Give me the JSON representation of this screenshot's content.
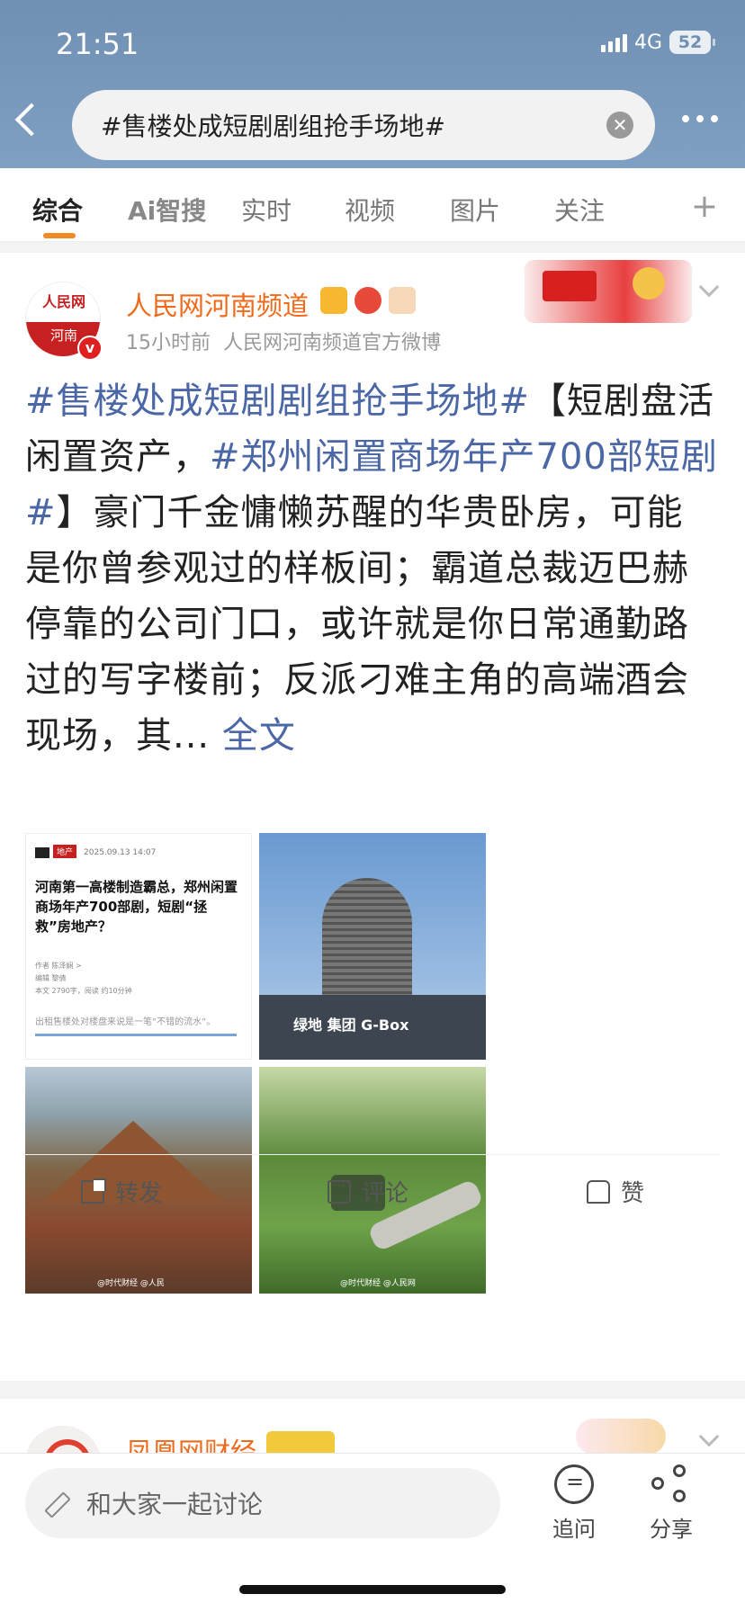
{
  "status_bar": {
    "time": "21:51",
    "network": "4G",
    "battery": "52"
  },
  "search": {
    "query": "#售楼处成短剧剧组抢手场地#"
  },
  "tabs": [
    {
      "label": "综合",
      "active": true
    },
    {
      "label": "Ai智搜",
      "active": false
    },
    {
      "label": "实时",
      "active": false
    },
    {
      "label": "视频",
      "active": false
    },
    {
      "label": "图片",
      "active": false
    },
    {
      "label": "关注",
      "active": false
    }
  ],
  "post": {
    "avatar_top": "人民网",
    "avatar_bottom": "河南",
    "author": "人民网河南频道",
    "time": "15小时前",
    "source": "人民网河南频道官方微博",
    "hashtag1": "#售楼处成短剧剧组抢手场地#",
    "text1": "【短剧盘活闲置资产，",
    "hashtag2": "#郑州闲置商场年产700部短剧#",
    "text2": "】豪门千金慵懒苏醒的华贵卧房，可能是你曾参观过的样板间；霸道总裁迈巴赫停靠的公司门口，或许就是你日常通勤路过的写字楼前；反派刁难主角的高端酒会现场，其...",
    "full_text": "全文",
    "image1": {
      "tag": "地产",
      "date": "2025.09.13 14:07",
      "title": "河南第一高楼制造霸总，郑州闲置商场年产700部剧，短剧“拯救”房地产？",
      "author_line": "作者 陈泽娴 >",
      "editor_line": "编辑 黎倩",
      "stats": "本文 2790字，阅读 约10分钟",
      "quote": "出租售楼处对楼盘来说是一笔“不错的流水”。"
    },
    "image2": {
      "sign_text": "绿地 集团  G-Box"
    },
    "image3": {
      "watermark": "@时代财经  @人民"
    },
    "image4": {
      "watermark": "@时代财经  @人民网"
    },
    "actions": {
      "repost": "转发",
      "comment": "评论",
      "like": "赞"
    }
  },
  "next_post": {
    "author": "凤凰网财经"
  },
  "bottom_bar": {
    "discuss_placeholder": "和大家一起讨论",
    "ask": "追问",
    "share": "分享"
  }
}
